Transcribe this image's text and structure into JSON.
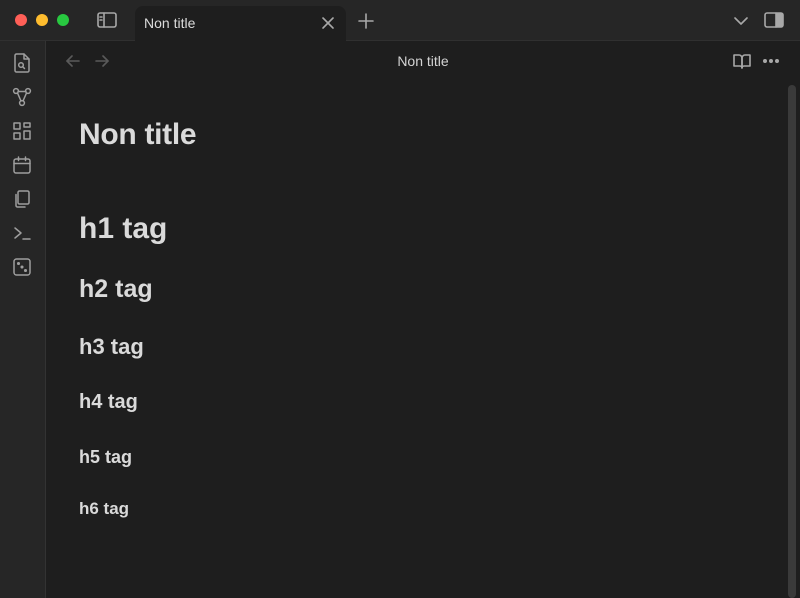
{
  "tab": {
    "title": "Non title"
  },
  "view": {
    "title": "Non title"
  },
  "note": {
    "title": "Non title",
    "headings": {
      "h1": "h1 tag",
      "h2": "h2 tag",
      "h3": "h3 tag",
      "h4": "h4 tag",
      "h5": "h5 tag",
      "h6": "h6 tag"
    }
  },
  "icons": {
    "titlebar": [
      "sidebar-toggle-icon",
      "close-icon",
      "plus-icon",
      "chevron-down-icon",
      "right-sidebar-icon"
    ],
    "ribbon": [
      "open-quick-switcher-icon",
      "graph-view-icon",
      "canvas-icon",
      "calendar-icon",
      "templates-icon",
      "command-palette-icon",
      "random-note-icon"
    ],
    "header": [
      "arrow-left-icon",
      "arrow-right-icon",
      "reading-view-icon",
      "more-options-icon"
    ]
  },
  "colors": {
    "close": "#ff5f57",
    "minimize": "#febc2e",
    "maximize": "#28c840",
    "background": "#1e1e1e",
    "chrome": "#262626",
    "text": "#dadada"
  }
}
